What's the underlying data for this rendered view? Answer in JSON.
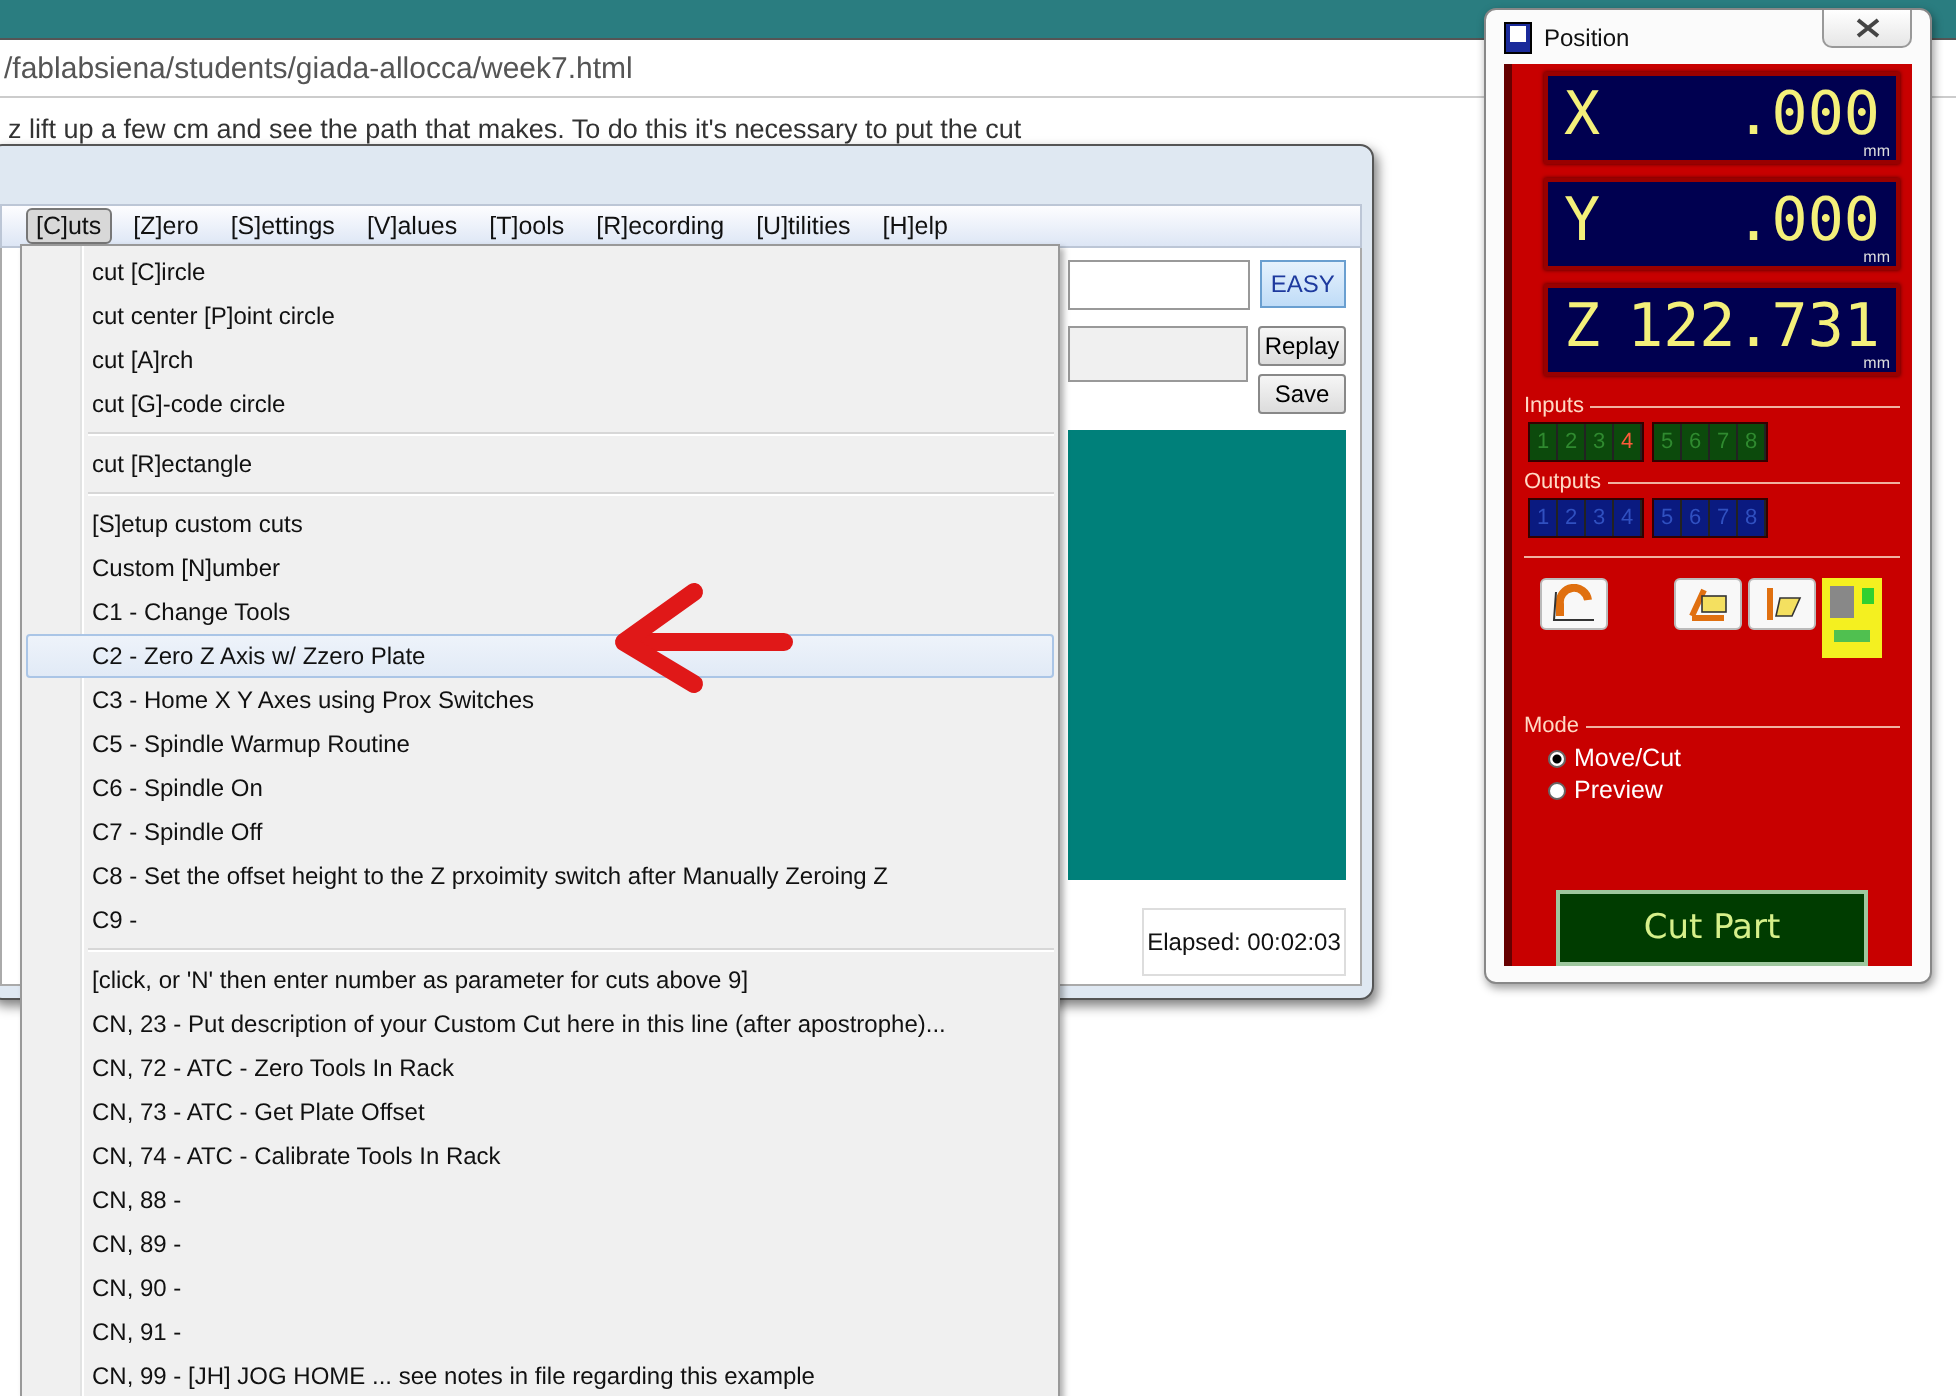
{
  "browser": {
    "address": "/fablabsiena/students/giada-allocca/week7.html",
    "page_text": "z lift up a few cm and see the path that makes. To do this it's necessary to put the cut"
  },
  "app": {
    "menu": [
      {
        "label": "[C]uts",
        "selected": true
      },
      {
        "label": "[Z]ero",
        "selected": false
      },
      {
        "label": "[S]ettings",
        "selected": false
      },
      {
        "label": "[V]alues",
        "selected": false
      },
      {
        "label": "[T]ools",
        "selected": false
      },
      {
        "label": "[R]ecording",
        "selected": false
      },
      {
        "label": "[U]tilities",
        "selected": false
      },
      {
        "label": "[H]elp",
        "selected": false
      }
    ],
    "easy_button": "EASY",
    "replay_button": "Replay",
    "save_button": "Save",
    "elapsed": "Elapsed: 00:02:03"
  },
  "dropdown": [
    {
      "kind": "item",
      "label": "cut [C]ircle",
      "selected": false
    },
    {
      "kind": "item",
      "label": "cut center [P]oint circle",
      "selected": false
    },
    {
      "kind": "item",
      "label": "cut [A]rch",
      "selected": false
    },
    {
      "kind": "item",
      "label": "cut [G]-code circle",
      "selected": false
    },
    {
      "kind": "separator"
    },
    {
      "kind": "item",
      "label": "cut [R]ectangle",
      "selected": false
    },
    {
      "kind": "separator"
    },
    {
      "kind": "item",
      "label": "[S]etup custom cuts",
      "selected": false
    },
    {
      "kind": "item",
      "label": "Custom [N]umber",
      "selected": false
    },
    {
      "kind": "item",
      "label": "C1  -  Change Tools",
      "selected": false
    },
    {
      "kind": "item",
      "label": "C2  -  Zero Z Axis w/ Zzero Plate",
      "selected": true
    },
    {
      "kind": "item",
      "label": "C3  -  Home X  Y Axes using Prox Switches",
      "selected": false
    },
    {
      "kind": "item",
      "label": "C5  -  Spindle Warmup Routine",
      "selected": false
    },
    {
      "kind": "item",
      "label": "C6  -  Spindle On",
      "selected": false
    },
    {
      "kind": "item",
      "label": "C7  -  Spindle Off",
      "selected": false
    },
    {
      "kind": "item",
      "label": "C8  -  Set the offset height to the Z prxoimity switch after Manually Zeroing Z",
      "selected": false
    },
    {
      "kind": "item",
      "label": "C9  -",
      "selected": false
    },
    {
      "kind": "separator"
    },
    {
      "kind": "item",
      "label": "[click, or 'N' then enter number as parameter for cuts above 9]",
      "selected": false
    },
    {
      "kind": "item",
      "label": "CN, 23  -  Put description of your Custom Cut here in this line (after apostrophe)...",
      "selected": false
    },
    {
      "kind": "item",
      "label": "CN, 72  -  ATC - Zero Tools In Rack",
      "selected": false
    },
    {
      "kind": "item",
      "label": "CN, 73  -  ATC - Get Plate Offset",
      "selected": false
    },
    {
      "kind": "item",
      "label": "CN, 74  -  ATC - Calibrate Tools In Rack",
      "selected": false
    },
    {
      "kind": "item",
      "label": "CN, 88  -",
      "selected": false
    },
    {
      "kind": "item",
      "label": "CN, 89  -",
      "selected": false
    },
    {
      "kind": "item",
      "label": "CN, 90  -",
      "selected": false
    },
    {
      "kind": "item",
      "label": "CN, 91  -",
      "selected": false
    },
    {
      "kind": "item",
      "label": "CN, 99  -  [JH] JOG HOME ... see notes in file regarding this example",
      "selected": false
    }
  ],
  "position": {
    "title": "Position",
    "axes": [
      {
        "axis": "X",
        "value": ".000",
        "unit": "mm"
      },
      {
        "axis": "Y",
        "value": ".000",
        "unit": "mm"
      },
      {
        "axis": "Z",
        "value": "122.731",
        "unit": "mm"
      }
    ],
    "inputs_label": "Inputs",
    "inputs": [
      {
        "label": "1",
        "on": false
      },
      {
        "label": "2",
        "on": false
      },
      {
        "label": "3",
        "on": false
      },
      {
        "label": "4",
        "on": true
      },
      {
        "label": "5",
        "on": false
      },
      {
        "label": "6",
        "on": false
      },
      {
        "label": "7",
        "on": false
      },
      {
        "label": "8",
        "on": false
      }
    ],
    "outputs_label": "Outputs",
    "outputs": [
      {
        "label": "1",
        "on": false
      },
      {
        "label": "2",
        "on": false
      },
      {
        "label": "3",
        "on": false
      },
      {
        "label": "4",
        "on": false
      },
      {
        "label": "5",
        "on": false
      },
      {
        "label": "6",
        "on": false
      },
      {
        "label": "7",
        "on": false
      },
      {
        "label": "8",
        "on": false
      }
    ],
    "mode_label": "Mode",
    "modes": [
      {
        "label": "Move/Cut",
        "selected": true
      },
      {
        "label": "Preview",
        "selected": false
      }
    ],
    "cut_button": "Cut Part"
  }
}
